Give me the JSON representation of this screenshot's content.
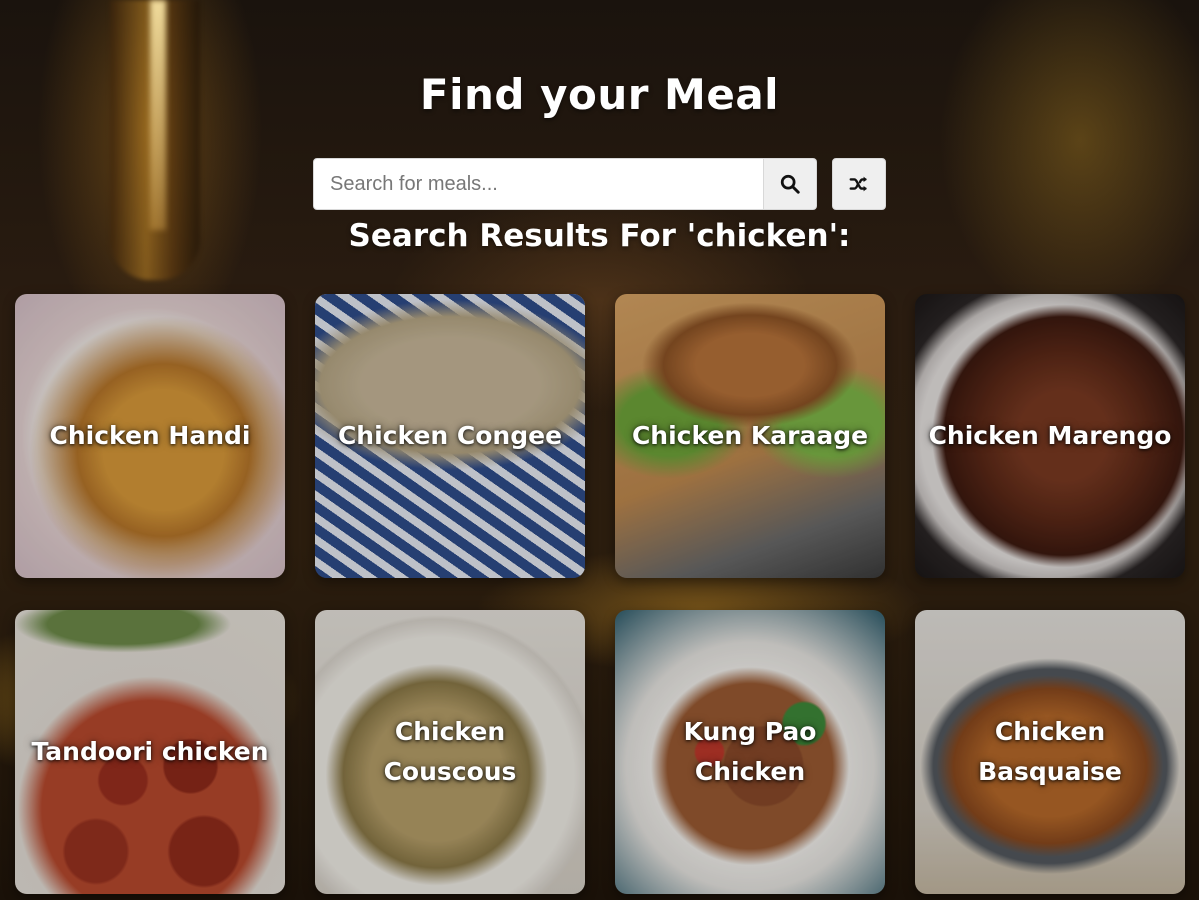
{
  "header": {
    "title": "Find your Meal"
  },
  "search": {
    "placeholder": "Search for meals...",
    "value": "",
    "submit_icon": "search-icon",
    "random_icon": "shuffle-icon"
  },
  "results": {
    "heading": "Search Results For 'chicken':",
    "meals": [
      {
        "name": "Chicken Handi"
      },
      {
        "name": "Chicken Congee"
      },
      {
        "name": "Chicken Karaage"
      },
      {
        "name": "Chicken Marengo"
      },
      {
        "name": "Tandoori chicken"
      },
      {
        "name": "Chicken Couscous"
      },
      {
        "name": "Kung Pao Chicken"
      },
      {
        "name": "Chicken Basquaise"
      }
    ]
  }
}
